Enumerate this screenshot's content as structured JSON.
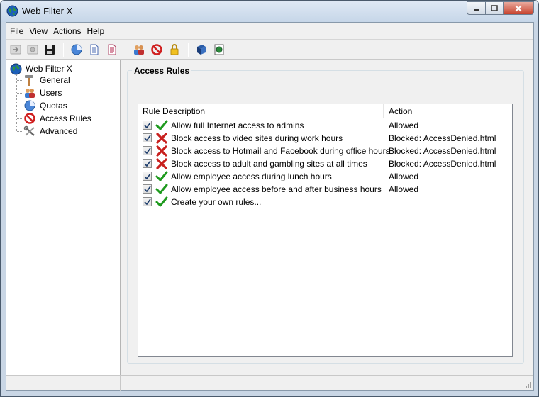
{
  "window": {
    "title": "Web Filter X"
  },
  "menu": {
    "items": [
      "File",
      "View",
      "Actions",
      "Help"
    ]
  },
  "toolbar": {
    "icons": [
      "forward-icon",
      "settings-icon",
      "save-icon",
      "pie-chart-icon",
      "document-blue-icon",
      "document-red-icon",
      "users-icon",
      "block-icon",
      "lock-icon",
      "book-icon",
      "globe-doc-icon"
    ]
  },
  "sidebar": {
    "root_label": "Web Filter X",
    "items": [
      {
        "label": "General",
        "icon": "hammer-icon"
      },
      {
        "label": "Users",
        "icon": "users-icon"
      },
      {
        "label": "Quotas",
        "icon": "pie-chart-icon"
      },
      {
        "label": "Access Rules",
        "icon": "block-icon"
      },
      {
        "label": "Advanced",
        "icon": "tools-icon"
      }
    ]
  },
  "main": {
    "group_title": "Access Rules",
    "columns": [
      "Rule Description",
      "Action"
    ],
    "rows": [
      {
        "checked": true,
        "status": "allow",
        "description": "Allow full Internet access to admins",
        "action": "Allowed"
      },
      {
        "checked": true,
        "status": "block",
        "description": "Block access to video sites during work hours",
        "action": "Blocked: AccessDenied.html"
      },
      {
        "checked": true,
        "status": "block",
        "description": "Block access to Hotmail and Facebook during office hours",
        "action": "Blocked: AccessDenied.html"
      },
      {
        "checked": true,
        "status": "block",
        "description": "Block access to adult and gambling sites at all times",
        "action": "Blocked: AccessDenied.html"
      },
      {
        "checked": true,
        "status": "allow",
        "description": "Allow employee access during lunch hours",
        "action": "Allowed"
      },
      {
        "checked": true,
        "status": "allow",
        "description": "Allow employee access before and after business hours",
        "action": "Allowed"
      },
      {
        "checked": true,
        "status": "allow",
        "description": "Create your own rules...",
        "action": ""
      }
    ]
  },
  "colors": {
    "allow": "#1e9a1e",
    "block": "#c8201e",
    "title_bar": "#c6d6e8"
  }
}
